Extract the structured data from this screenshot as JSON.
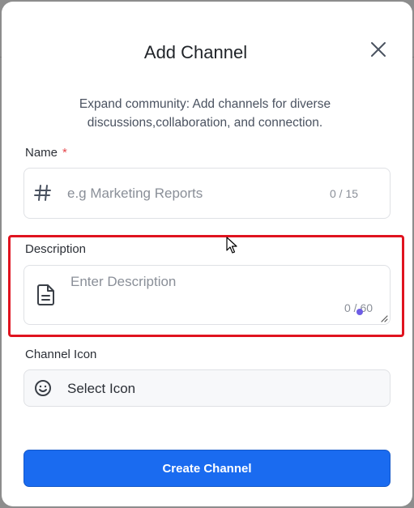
{
  "dialog": {
    "title": "Add Channel",
    "subtitle": "Expand community: Add channels for diverse discussions,collaboration, and connection."
  },
  "name_field": {
    "label": "Name",
    "required_mark": "*",
    "placeholder": "e.g Marketing Reports",
    "value": "",
    "counter": "0 / 15",
    "icon": "hash-icon"
  },
  "description_field": {
    "label": "Description",
    "placeholder": "Enter Description",
    "value": "",
    "counter": "0 / 60",
    "icon": "document-icon"
  },
  "channel_icon_field": {
    "label": "Channel Icon",
    "value": "Select Icon",
    "icon": "smiley-icon"
  },
  "actions": {
    "create_label": "Create Channel"
  },
  "colors": {
    "primary": "#1a6bf0",
    "required": "#e5484d",
    "highlight": "#e0131f"
  }
}
